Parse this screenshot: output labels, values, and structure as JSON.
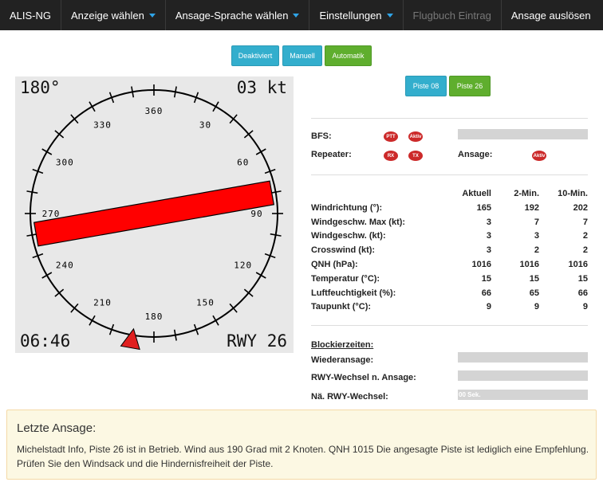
{
  "navbar": {
    "brand": "ALIS-NG",
    "items": [
      {
        "label": "Anzeige wählen",
        "dropdown": true,
        "disabled": false
      },
      {
        "label": "Ansage-Sprache wählen",
        "dropdown": true,
        "disabled": false
      },
      {
        "label": "Einstellungen",
        "dropdown": true,
        "disabled": false
      },
      {
        "label": "Flugbuch Eintrag",
        "dropdown": false,
        "disabled": true
      },
      {
        "label": "Ansage auslösen",
        "dropdown": false,
        "disabled": false
      }
    ]
  },
  "mode_buttons": {
    "deaktiviert": "Deaktiviert",
    "manuell": "Manuell",
    "automatik": "Automatik"
  },
  "runway_buttons": {
    "piste08": "Piste 08",
    "piste26": "Piste 26"
  },
  "compass": {
    "heading": "180°",
    "speed": "03 kt",
    "time": "06:46",
    "runway": "RWY 26",
    "scale_labels": [
      "360",
      "30",
      "60",
      "90",
      "120",
      "150",
      "180",
      "210",
      "240",
      "270",
      "300",
      "330"
    ],
    "runway_heading_deg": 260,
    "wind_direction_deg": 190,
    "colors": {
      "runway": "#ff0000",
      "wind_arrow": "#e02020",
      "background": "#e8e8e8"
    }
  },
  "status": {
    "bfs_label": "BFS:",
    "ptt": "PTT",
    "aktiv": "Aktiv",
    "repeater_label": "Repeater:",
    "rx": "RX",
    "tx": "TX",
    "ansage_label": "Ansage:",
    "ansage_aktiv": "Aktiv"
  },
  "weather": {
    "columns": [
      "Aktuell",
      "2-Min.",
      "10-Min."
    ],
    "rows": [
      {
        "label": "Windrichtung (°):",
        "values": [
          "165",
          "192",
          "202"
        ]
      },
      {
        "label": "Windgeschw. Max (kt):",
        "values": [
          "3",
          "7",
          "7"
        ]
      },
      {
        "label": "Windgeschw. (kt):",
        "values": [
          "3",
          "3",
          "2"
        ]
      },
      {
        "label": "Crosswind (kt):",
        "values": [
          "3",
          "2",
          "2"
        ]
      },
      {
        "label": "QNH (hPa):",
        "values": [
          "1016",
          "1016",
          "1016"
        ]
      },
      {
        "label": "Temperatur (°C):",
        "values": [
          "15",
          "15",
          "15"
        ]
      },
      {
        "label": "Luftfeuchtigkeit (%):",
        "values": [
          "66",
          "65",
          "66"
        ]
      },
      {
        "label": "Taupunkt (°C):",
        "values": [
          "9",
          "9",
          "9"
        ]
      }
    ]
  },
  "blocking": {
    "title": "Blockierzeiten:",
    "wiederansage": "Wiederansage:",
    "rwy_wechsel_ansage": "RWY-Wechsel n. Ansage:",
    "naechster_rwy_wechsel": "Nä. RWY-Wechsel:",
    "progress_text": "00 Sek."
  },
  "last_announcement": {
    "title": "Letzte Ansage:",
    "text": "Michelstadt Info, Piste 26 ist in Betrieb. Wind aus 190 Grad mit 2 Knoten. QNH 1015 Die angesagte Piste ist lediglich eine Empfehlung. Prüfen Sie den Windsack und die Hindernisfreiheit der Piste."
  }
}
